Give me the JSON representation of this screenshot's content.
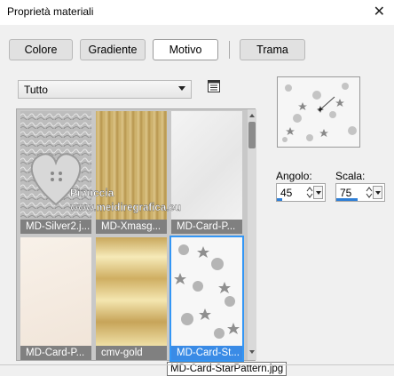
{
  "window": {
    "title": "Proprietà materiali"
  },
  "tabs": [
    {
      "label": "Colore",
      "active": false
    },
    {
      "label": "Gradiente",
      "active": false
    },
    {
      "label": "Motivo",
      "active": true
    },
    {
      "label": "Trama",
      "active": false
    }
  ],
  "category_select": {
    "value": "Tutto"
  },
  "gallery": {
    "items": [
      {
        "caption": "MD-Silver2.j...",
        "selected": false
      },
      {
        "caption": "MD-Xmasg...",
        "selected": false
      },
      {
        "caption": "MD-Card-P...",
        "selected": false
      },
      {
        "caption": "MD-Card-P...",
        "selected": false
      },
      {
        "caption": "cmv-gold",
        "selected": false
      },
      {
        "caption": "MD-Card-St...",
        "selected": true
      }
    ],
    "watermark": "Pinuccia\nwww.meidiregrafica.eu",
    "tooltip": "MD-Card-StarPattern.jpg"
  },
  "angle": {
    "label": "Angolo:",
    "value": "45",
    "fill_fraction": 0.12
  },
  "scale": {
    "label": "Scala:",
    "value": "75",
    "fill_fraction": 0.45
  },
  "colors": {
    "accent": "#3396f5",
    "caption_bg": "#808080",
    "caption_selected_bg": "#3a8be6"
  }
}
